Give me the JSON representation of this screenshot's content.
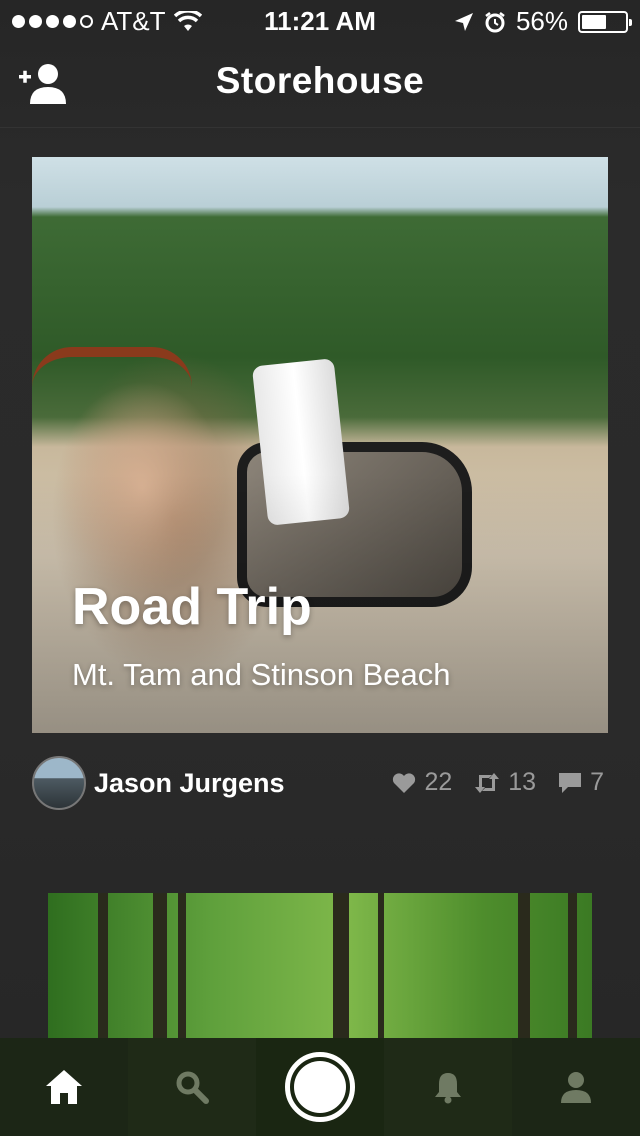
{
  "status_bar": {
    "carrier": "AT&T",
    "time": "11:21 AM",
    "battery": "56%",
    "battery_level": 0.56,
    "signal_bars": 4
  },
  "nav": {
    "title": "Storehouse",
    "add_user_icon": "add-user-icon"
  },
  "feed": {
    "cards": [
      {
        "title": "Road Trip",
        "subtitle": "Mt. Tam and Stinson Beach",
        "author": "Jason Jurgens",
        "likes": "22",
        "reposts": "13",
        "comments": "7"
      }
    ]
  },
  "tabs": [
    {
      "name": "home",
      "icon": "home-icon",
      "active": true
    },
    {
      "name": "search",
      "icon": "search-icon"
    },
    {
      "name": "capture",
      "icon": "capture-icon"
    },
    {
      "name": "notifications",
      "icon": "bell-icon"
    },
    {
      "name": "profile",
      "icon": "profile-icon"
    }
  ],
  "colors": {
    "background": "#262626",
    "tab_bar": "#1f2a17",
    "stat_gray": "#9a9a9a"
  }
}
